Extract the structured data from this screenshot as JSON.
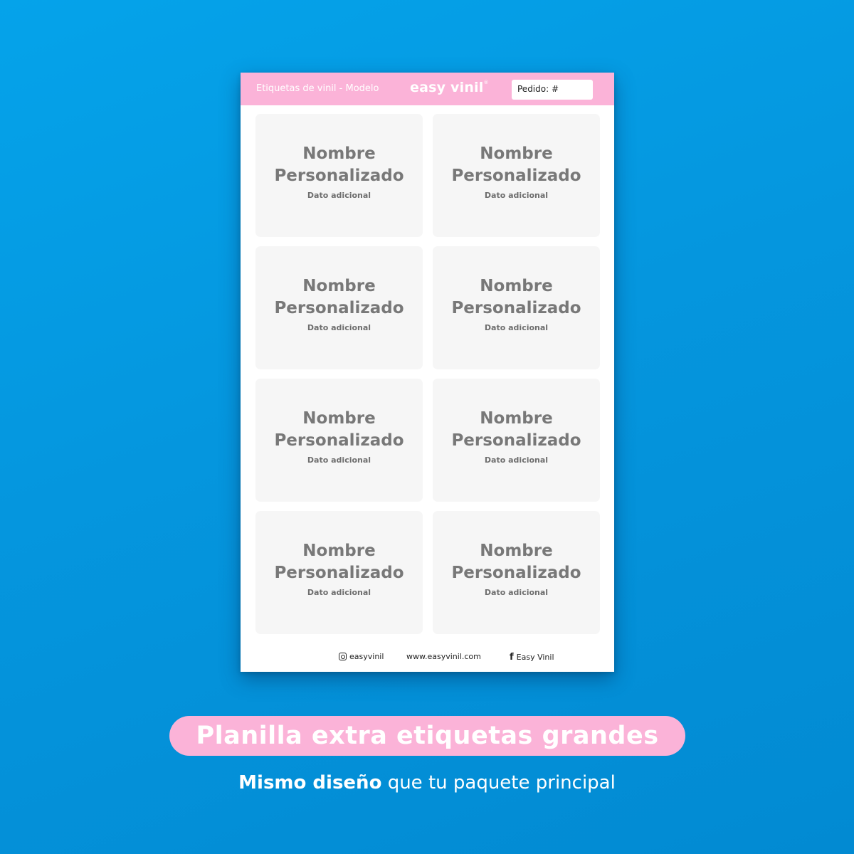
{
  "sheet": {
    "title": "Etiquetas de vinil - Modelo",
    "brand": "easy vinil",
    "brand_mark": "®",
    "order_label": "Pedido: #",
    "labels": [
      {
        "name_line1": "Nombre",
        "name_line2": "Personalizado",
        "extra": "Dato adicional"
      },
      {
        "name_line1": "Nombre",
        "name_line2": "Personalizado",
        "extra": "Dato adicional"
      },
      {
        "name_line1": "Nombre",
        "name_line2": "Personalizado",
        "extra": "Dato adicional"
      },
      {
        "name_line1": "Nombre",
        "name_line2": "Personalizado",
        "extra": "Dato adicional"
      },
      {
        "name_line1": "Nombre",
        "name_line2": "Personalizado",
        "extra": "Dato adicional"
      },
      {
        "name_line1": "Nombre",
        "name_line2": "Personalizado",
        "extra": "Dato adicional"
      },
      {
        "name_line1": "Nombre",
        "name_line2": "Personalizado",
        "extra": "Dato adicional"
      },
      {
        "name_line1": "Nombre",
        "name_line2": "Personalizado",
        "extra": "Dato adicional"
      }
    ],
    "footer": {
      "instagram": "easyvinil",
      "instagram_icon": "instagram-icon",
      "website": "www.easyvinil.com",
      "facebook": "Easy Vinil",
      "facebook_icon": "facebook-icon"
    }
  },
  "banner": {
    "title": "Planilla extra etiquetas grandes",
    "tagline_bold": "Mismo diseño",
    "tagline_rest": " que tu paquete principal"
  },
  "colors": {
    "background": "#0596de",
    "accent_pink": "#fbb3d8",
    "label_fill": "#f6f6f6",
    "label_text": "#787878"
  }
}
